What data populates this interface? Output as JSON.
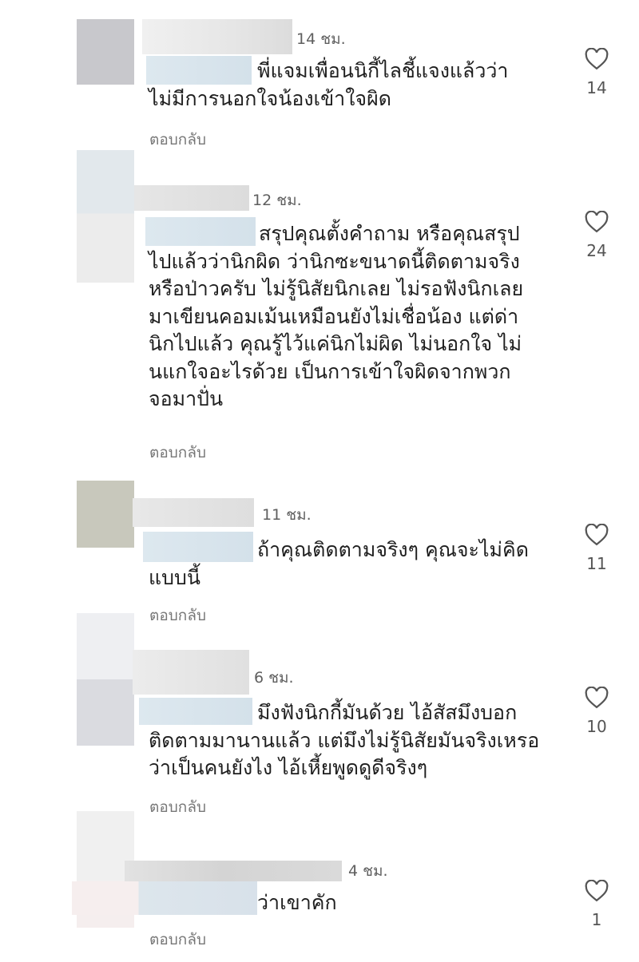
{
  "comments": [
    {
      "time": "14 ชม.",
      "text": "พี่แจมเพื่อนนิกี้ไลชี้แจงแล้วว่า\nไม่มีการนอกใจน้องเข้าใจผิด",
      "reply_label": "ตอบกลับ",
      "likes": "14"
    },
    {
      "time": "12 ชม.",
      "text": "สรุปคุณตั้งคำถาม หรือคุณสรุป\nไปแล้วว่านิกผิด  ว่านิกซะขนาดนี้ติดตามจริง\nหรือป่าวครับ ไม่รู้นิสัยนิกเลย ไม่รอฟังนิกเลย\nมาเขียนคอมเม้นเหมือนยังไม่เชื่อน้อง แต่ด่า\nนิกไปแล้ว  คุณรู้ไว้แค่นิกไม่ผิด ไม่นอกใจ ไม่\nนแกใจอะไรด้วย เป็นการเข้าใจผิดจากพวก\nจอมาปั่น",
      "reply_label": "ตอบกลับ",
      "likes": "24"
    },
    {
      "time": "11 ชม.",
      "text": "ถ้าคุณติดตามจริงๆ คุณจะไม่คิด\nแบบนี้",
      "reply_label": "ตอบกลับ",
      "likes": "11"
    },
    {
      "time": "6 ชม.",
      "text": "มึงฟังนิกกี้มันด้วย ไอ้สัสมึงบอก\nติดตามมานานแล้ว แต่มึงไม่รู้นิสัยมันจริงเหรอ\nว่าเป็นคนยังไง ไอ้เหี้ยพูดดูดีจริงๆ",
      "reply_label": "ตอบกลับ",
      "likes": "10"
    },
    {
      "time": "4 ชม.",
      "text": "ว่าเขาคัก",
      "reply_label": "ตอบกลับ",
      "likes": "1"
    }
  ],
  "icons": {
    "like": "heart-outline-icon"
  },
  "colors": {
    "text": "#1f1f1f",
    "meta": "#777777",
    "background": "#ffffff"
  }
}
